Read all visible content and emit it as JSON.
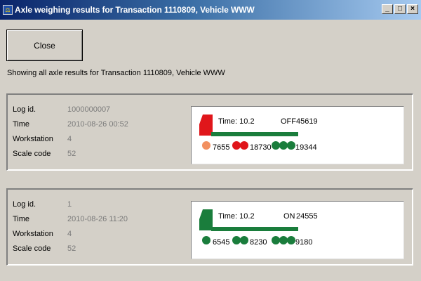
{
  "window": {
    "title": "Axle weighing results for Transaction 1110809,  Vehicle WWW",
    "icon": "app-scale-icon",
    "controls": {
      "minimize": "_",
      "maximize": "□",
      "close": "×"
    }
  },
  "close_button": {
    "label": "Close"
  },
  "info_line": "Showing all axle results for Transaction 1110809,  Vehicle WWW",
  "field_labels": {
    "log_id": "Log id.",
    "time": "Time",
    "workstation": "Workstation",
    "scale_code": "Scale code"
  },
  "records": [
    {
      "log_id": "1000000007",
      "time": "2010-08-26 00:52",
      "workstation": "4",
      "scale_code": "52",
      "graphic": {
        "time_text": "Time: 10.2",
        "status": "OFF",
        "total": "45619",
        "cab_color": "#e0161b",
        "axle_groups": [
          {
            "weight": "7655",
            "color": "#f29060",
            "count": 1
          },
          {
            "weight": "18730",
            "color": "#e0161b",
            "count": 2
          },
          {
            "weight": "19344",
            "color": "#1a7d3c",
            "count": 3
          }
        ]
      }
    },
    {
      "log_id": "1",
      "time": "2010-08-26 11:20",
      "workstation": "4",
      "scale_code": "52",
      "graphic": {
        "time_text": "Time: 10.2",
        "status": "ON",
        "total": "24555",
        "cab_color": "#1a7d3c",
        "axle_groups": [
          {
            "weight": "6545",
            "color": "#1a7d3c",
            "count": 1
          },
          {
            "weight": "8230",
            "color": "#1a7d3c",
            "count": 2
          },
          {
            "weight": "9180",
            "color": "#1a7d3c",
            "count": 3
          }
        ]
      }
    }
  ],
  "colors": {
    "frame_green": "#1a7d3c",
    "red": "#e0161b",
    "orange": "#f29060"
  }
}
